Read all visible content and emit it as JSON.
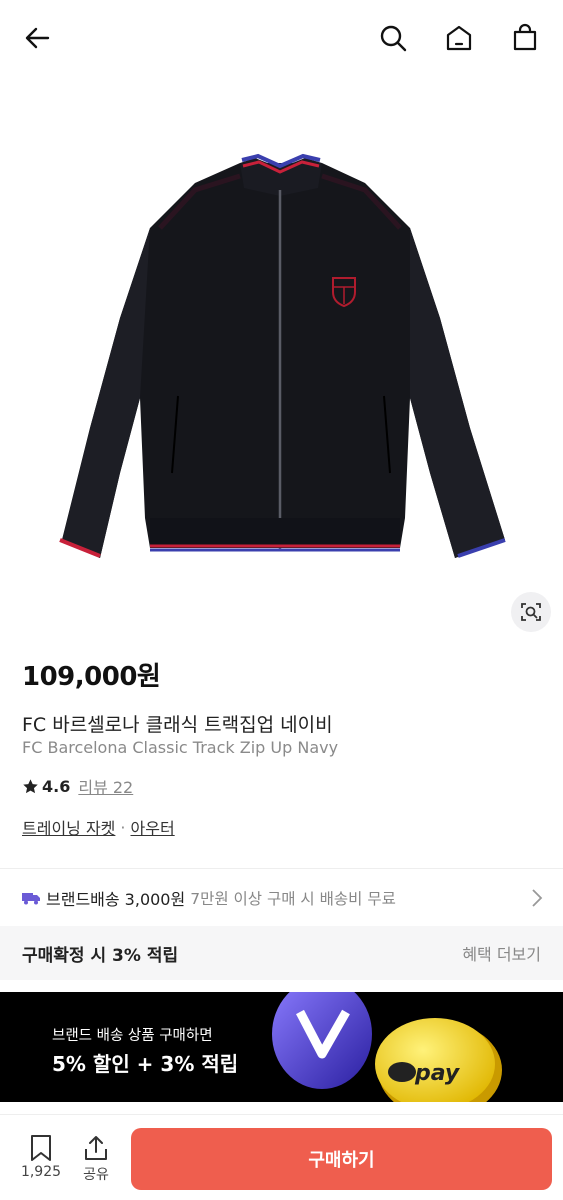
{
  "header": {
    "back_icon": "arrow-left-icon",
    "search_icon": "search-icon",
    "home_icon": "home-icon",
    "cart_icon": "shopping-bag-icon"
  },
  "product": {
    "price": "109,000원",
    "name_ko": "FC 바르셀로나 클래식 트랙집업 네이비",
    "name_en": "FC Barcelona Classic Track Zip Up Navy",
    "rating": "4.6",
    "review_label": "리뷰 22",
    "category_1": "트레이닝 자켓",
    "category_sep": "·",
    "category_2": "아우터"
  },
  "shipping": {
    "main": "브랜드배송 3,000원",
    "sub": "7만원 이상 구매 시 배송비 무료"
  },
  "benefit": {
    "title": "구매확정 시 3% 적립",
    "more": "혜택 더보기"
  },
  "banner": {
    "sub": "브랜드 배송 상품 구매하면",
    "main": "5% 할인 + 3% 적립",
    "coin_text": "pay"
  },
  "bottom": {
    "bookmark_count": "1,925",
    "share_label": "공유",
    "buy_label": "구매하기"
  },
  "colors": {
    "buy_button": "#ef5e4e",
    "banner_bg": "#000000",
    "jacket": "#15161b",
    "trim_red": "#c8213a",
    "trim_blue": "#3a3fae"
  }
}
